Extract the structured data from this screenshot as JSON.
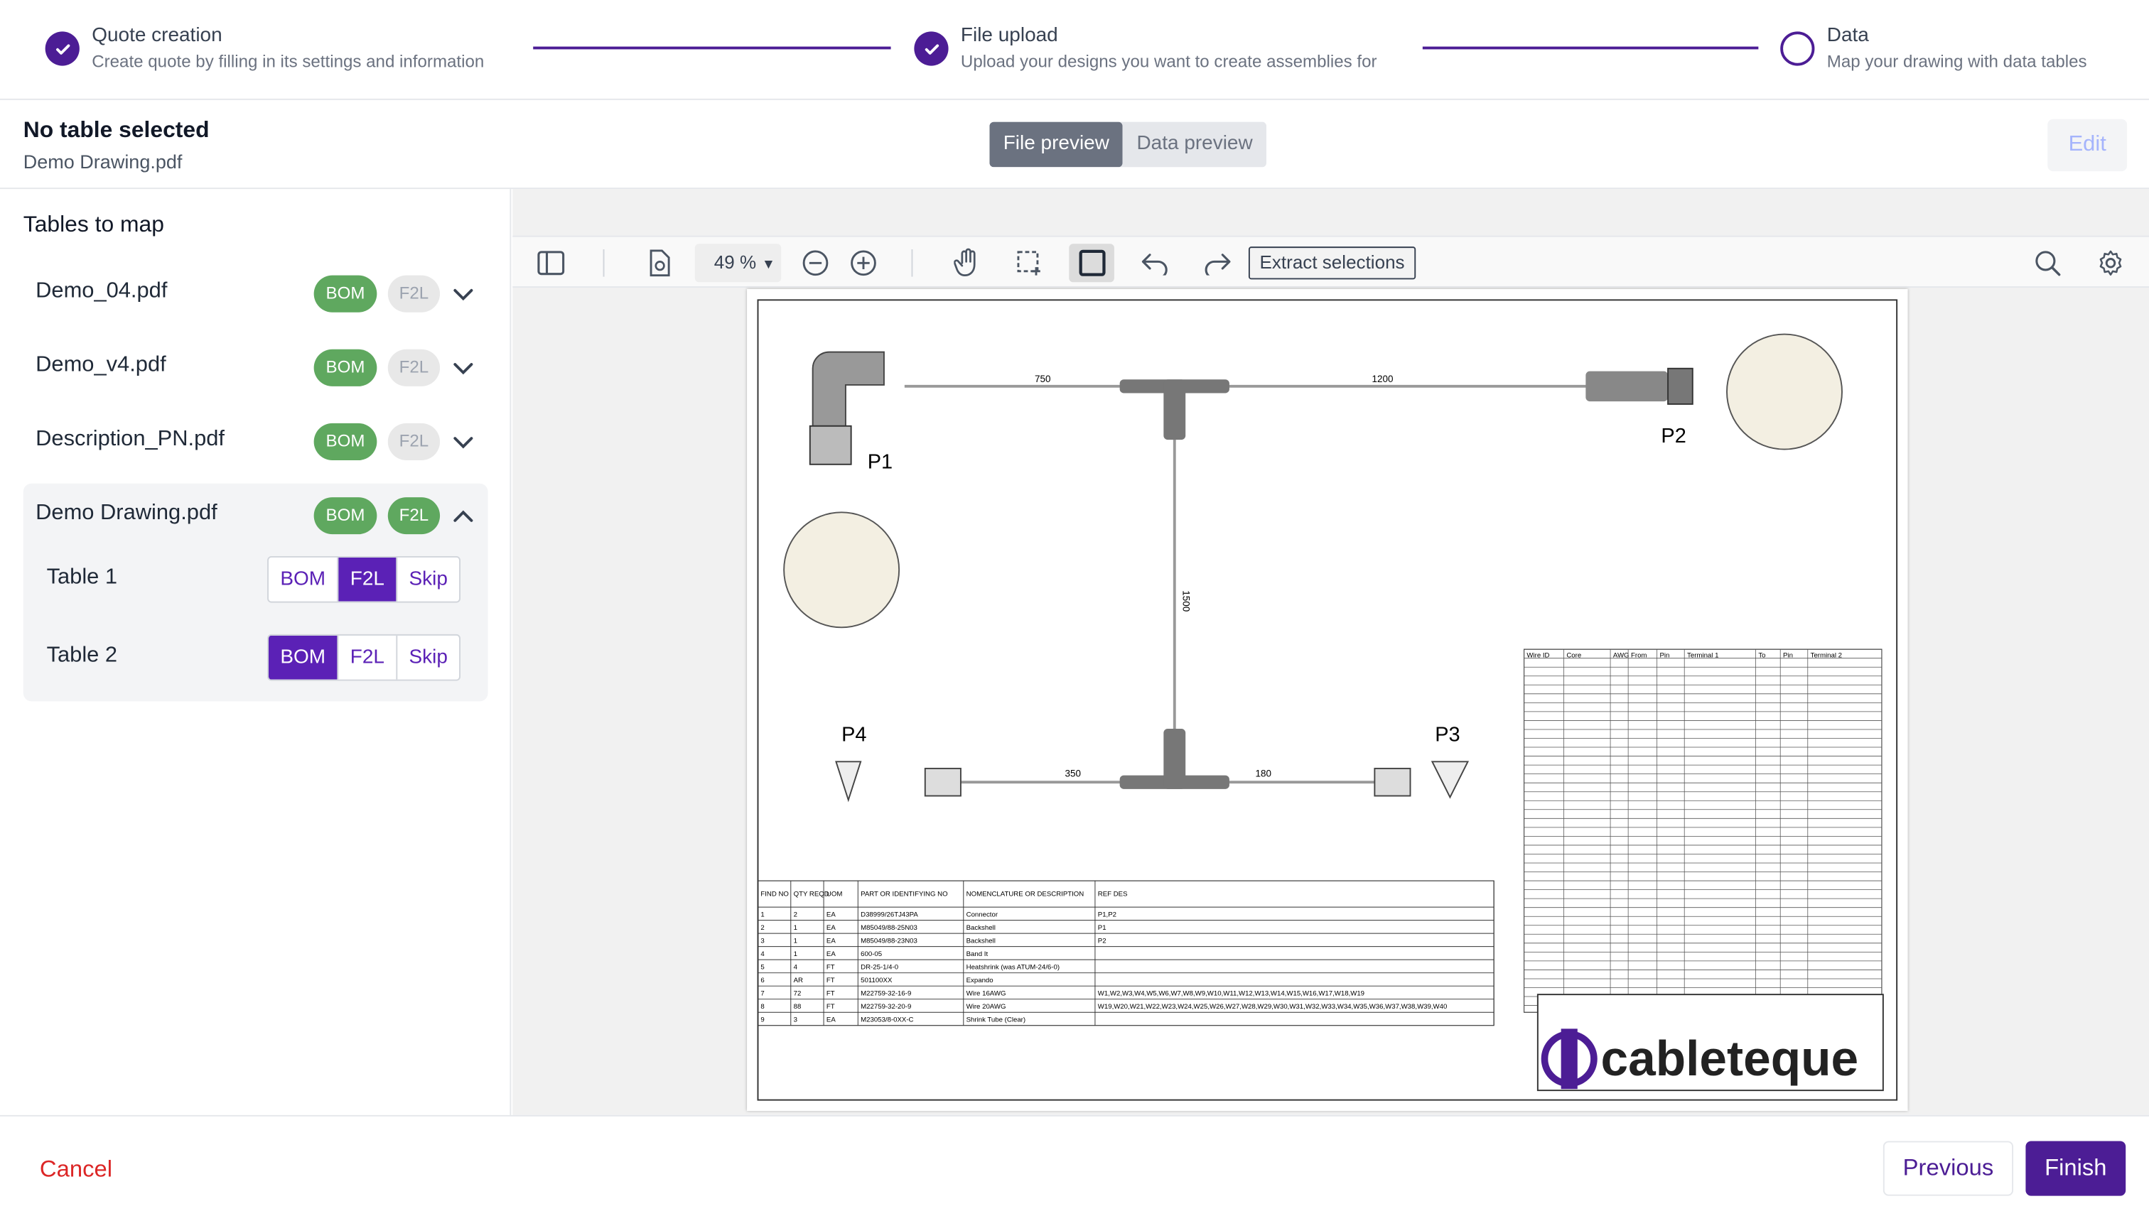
{
  "stepper": {
    "steps": [
      {
        "title": "Quote creation",
        "desc": "Create quote by filling in its settings and information",
        "status": "done"
      },
      {
        "title": "File upload",
        "desc": "Upload your designs you want to create assemblies for",
        "status": "done"
      },
      {
        "title": "Data",
        "desc": "Map your drawing with data tables",
        "status": "todo"
      }
    ]
  },
  "header": {
    "title": "No table selected",
    "filename": "Demo Drawing.pdf",
    "tabs": [
      "File preview",
      "Data preview"
    ],
    "active_tab": "File preview",
    "edit_label": "Edit"
  },
  "sidebar": {
    "heading": "Tables to map",
    "files": [
      {
        "name": "Demo_04.pdf",
        "bom": "BOM",
        "f2l": "F2L",
        "f2l_active": false
      },
      {
        "name": "Demo_v4.pdf",
        "bom": "BOM",
        "f2l": "F2L",
        "f2l_active": false
      },
      {
        "name": "Description_PN.pdf",
        "bom": "BOM",
        "f2l": "F2L",
        "f2l_active": false
      },
      {
        "name": "Demo Drawing.pdf",
        "bom": "BOM",
        "f2l": "F2L",
        "f2l_active": true,
        "expanded": true
      }
    ],
    "tables": [
      {
        "name": "Table 1",
        "options": [
          "BOM",
          "F2L",
          "Skip"
        ],
        "selected": "F2L"
      },
      {
        "name": "Table 2",
        "options": [
          "BOM",
          "F2L",
          "Skip"
        ],
        "selected": "BOM"
      }
    ]
  },
  "viewer": {
    "zoom": "49 %",
    "extract_label": "Extract selections",
    "drawing": {
      "connectors": [
        "P1",
        "P2",
        "P3",
        "P4"
      ],
      "dims": [
        "750",
        "1200",
        "1500",
        "350",
        "180"
      ],
      "bom_headers": [
        "FIND NO",
        "QTY REQD",
        "UOM",
        "PART OR IDENTIFYING NO",
        "NOMENCLATURE OR DESCRIPTION",
        "REF DES"
      ],
      "bom_rows": [
        [
          "1",
          "2",
          "EA",
          "D38999/26TJ43PA",
          "Connector",
          "P1,P2"
        ],
        [
          "2",
          "1",
          "EA",
          "M85049/88-25N03",
          "Backshell",
          "P1"
        ],
        [
          "3",
          "1",
          "EA",
          "M85049/88-23N03",
          "Backshell",
          "P2"
        ],
        [
          "4",
          "1",
          "EA",
          "600-05",
          "Band It",
          ""
        ],
        [
          "5",
          "4",
          "FT",
          "DR-25-1/4-0",
          "Heatshrink (was ATUM-24/6-0)",
          ""
        ],
        [
          "6",
          "AR",
          "FT",
          "501100XX",
          "Expando",
          ""
        ],
        [
          "7",
          "72",
          "FT",
          "M22759-32-16-9",
          "Wire 16AWG",
          "W1,W2,W3,W4,W5,W6,W7,W8,W9,W10,W11,W12,W13,W14,W15,W16,W17,W18,W19"
        ],
        [
          "8",
          "88",
          "FT",
          "M22759-32-20-9",
          "Wire 20AWG",
          "W19,W20,W21,W22,W23,W24,W25,W26,W27,W28,W29,W30,W31,W32,W33,W34,W35,W36,W37,W38,W39,W40"
        ],
        [
          "9",
          "3",
          "EA",
          "M23053/8-0XX-C",
          "Shrink Tube (Clear)",
          ""
        ]
      ],
      "wire_headers": [
        "Wire ID",
        "Core",
        "AWG",
        "From",
        "Pin",
        "Terminal 1",
        "To",
        "Pin",
        "Terminal 2"
      ],
      "logo_text": "cableteque"
    }
  },
  "footer": {
    "cancel": "Cancel",
    "previous": "Previous",
    "finish": "Finish"
  },
  "colors": {
    "primary": "#4c1d95",
    "pill_green": "#5fa85f",
    "danger": "#dc2626"
  }
}
